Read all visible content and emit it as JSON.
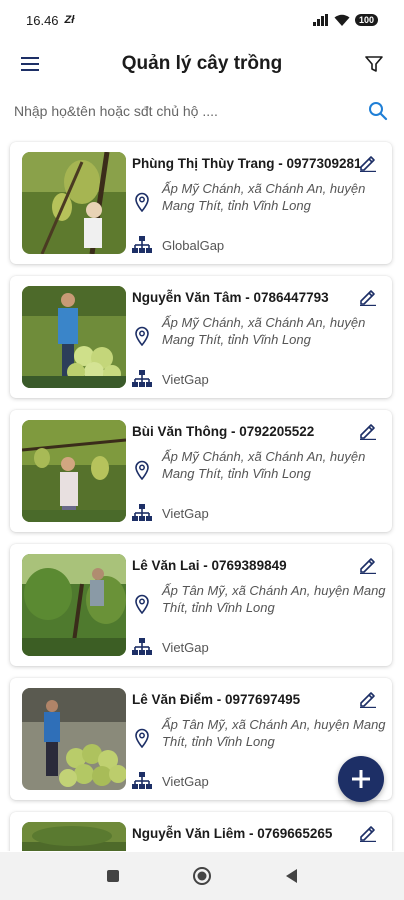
{
  "status": {
    "time": "16.46",
    "carrier_icon": "zalo-notification-icon",
    "battery": "100"
  },
  "header": {
    "title": "Quản lý cây trồng"
  },
  "search": {
    "placeholder": "Nhập họ&tên hoặc sđt chủ hộ ...."
  },
  "farmers": [
    {
      "name_phone": "Phùng Thị Thùy Trang - 0977309281",
      "address": "Ấp Mỹ Chánh, xã Chánh An, huyện Mang Thít, tỉnh Vĩnh Long",
      "standard": "GlobalGap"
    },
    {
      "name_phone": "Nguyễn Văn Tâm - 0786447793",
      "address": "Ấp Mỹ Chánh, xã Chánh An, huyện Mang Thít, tỉnh Vĩnh Long",
      "standard": "VietGap"
    },
    {
      "name_phone": "Bùi Văn Thông - 0792205522",
      "address": "Ấp Mỹ Chánh, xã Chánh An, huyện Mang Thít, tỉnh Vĩnh Long",
      "standard": "VietGap"
    },
    {
      "name_phone": "Lê Văn Lai - 0769389849",
      "address": "Ấp Tân Mỹ, xã Chánh An, huyện Mang Thít, tỉnh Vĩnh Long",
      "standard": "VietGap"
    },
    {
      "name_phone": "Lê Văn Điểm - 0977697495",
      "address": "Ấp Tân Mỹ, xã Chánh An, huyện Mang Thít, tỉnh Vĩnh Long",
      "standard": "VietGap"
    },
    {
      "name_phone": "Nguyễn Văn Liêm - 0769665265",
      "address": "",
      "standard": ""
    }
  ],
  "colors": {
    "accent": "#1d2f66",
    "search_icon": "#1f7fd6",
    "text_secondary": "#555555"
  },
  "icons": {
    "menu": "hamburger-menu-icon",
    "filter": "filter-icon",
    "search": "search-icon",
    "edit": "pencil-icon",
    "location": "location-pin-icon",
    "standard": "hierarchy-icon",
    "add": "plus-icon"
  }
}
